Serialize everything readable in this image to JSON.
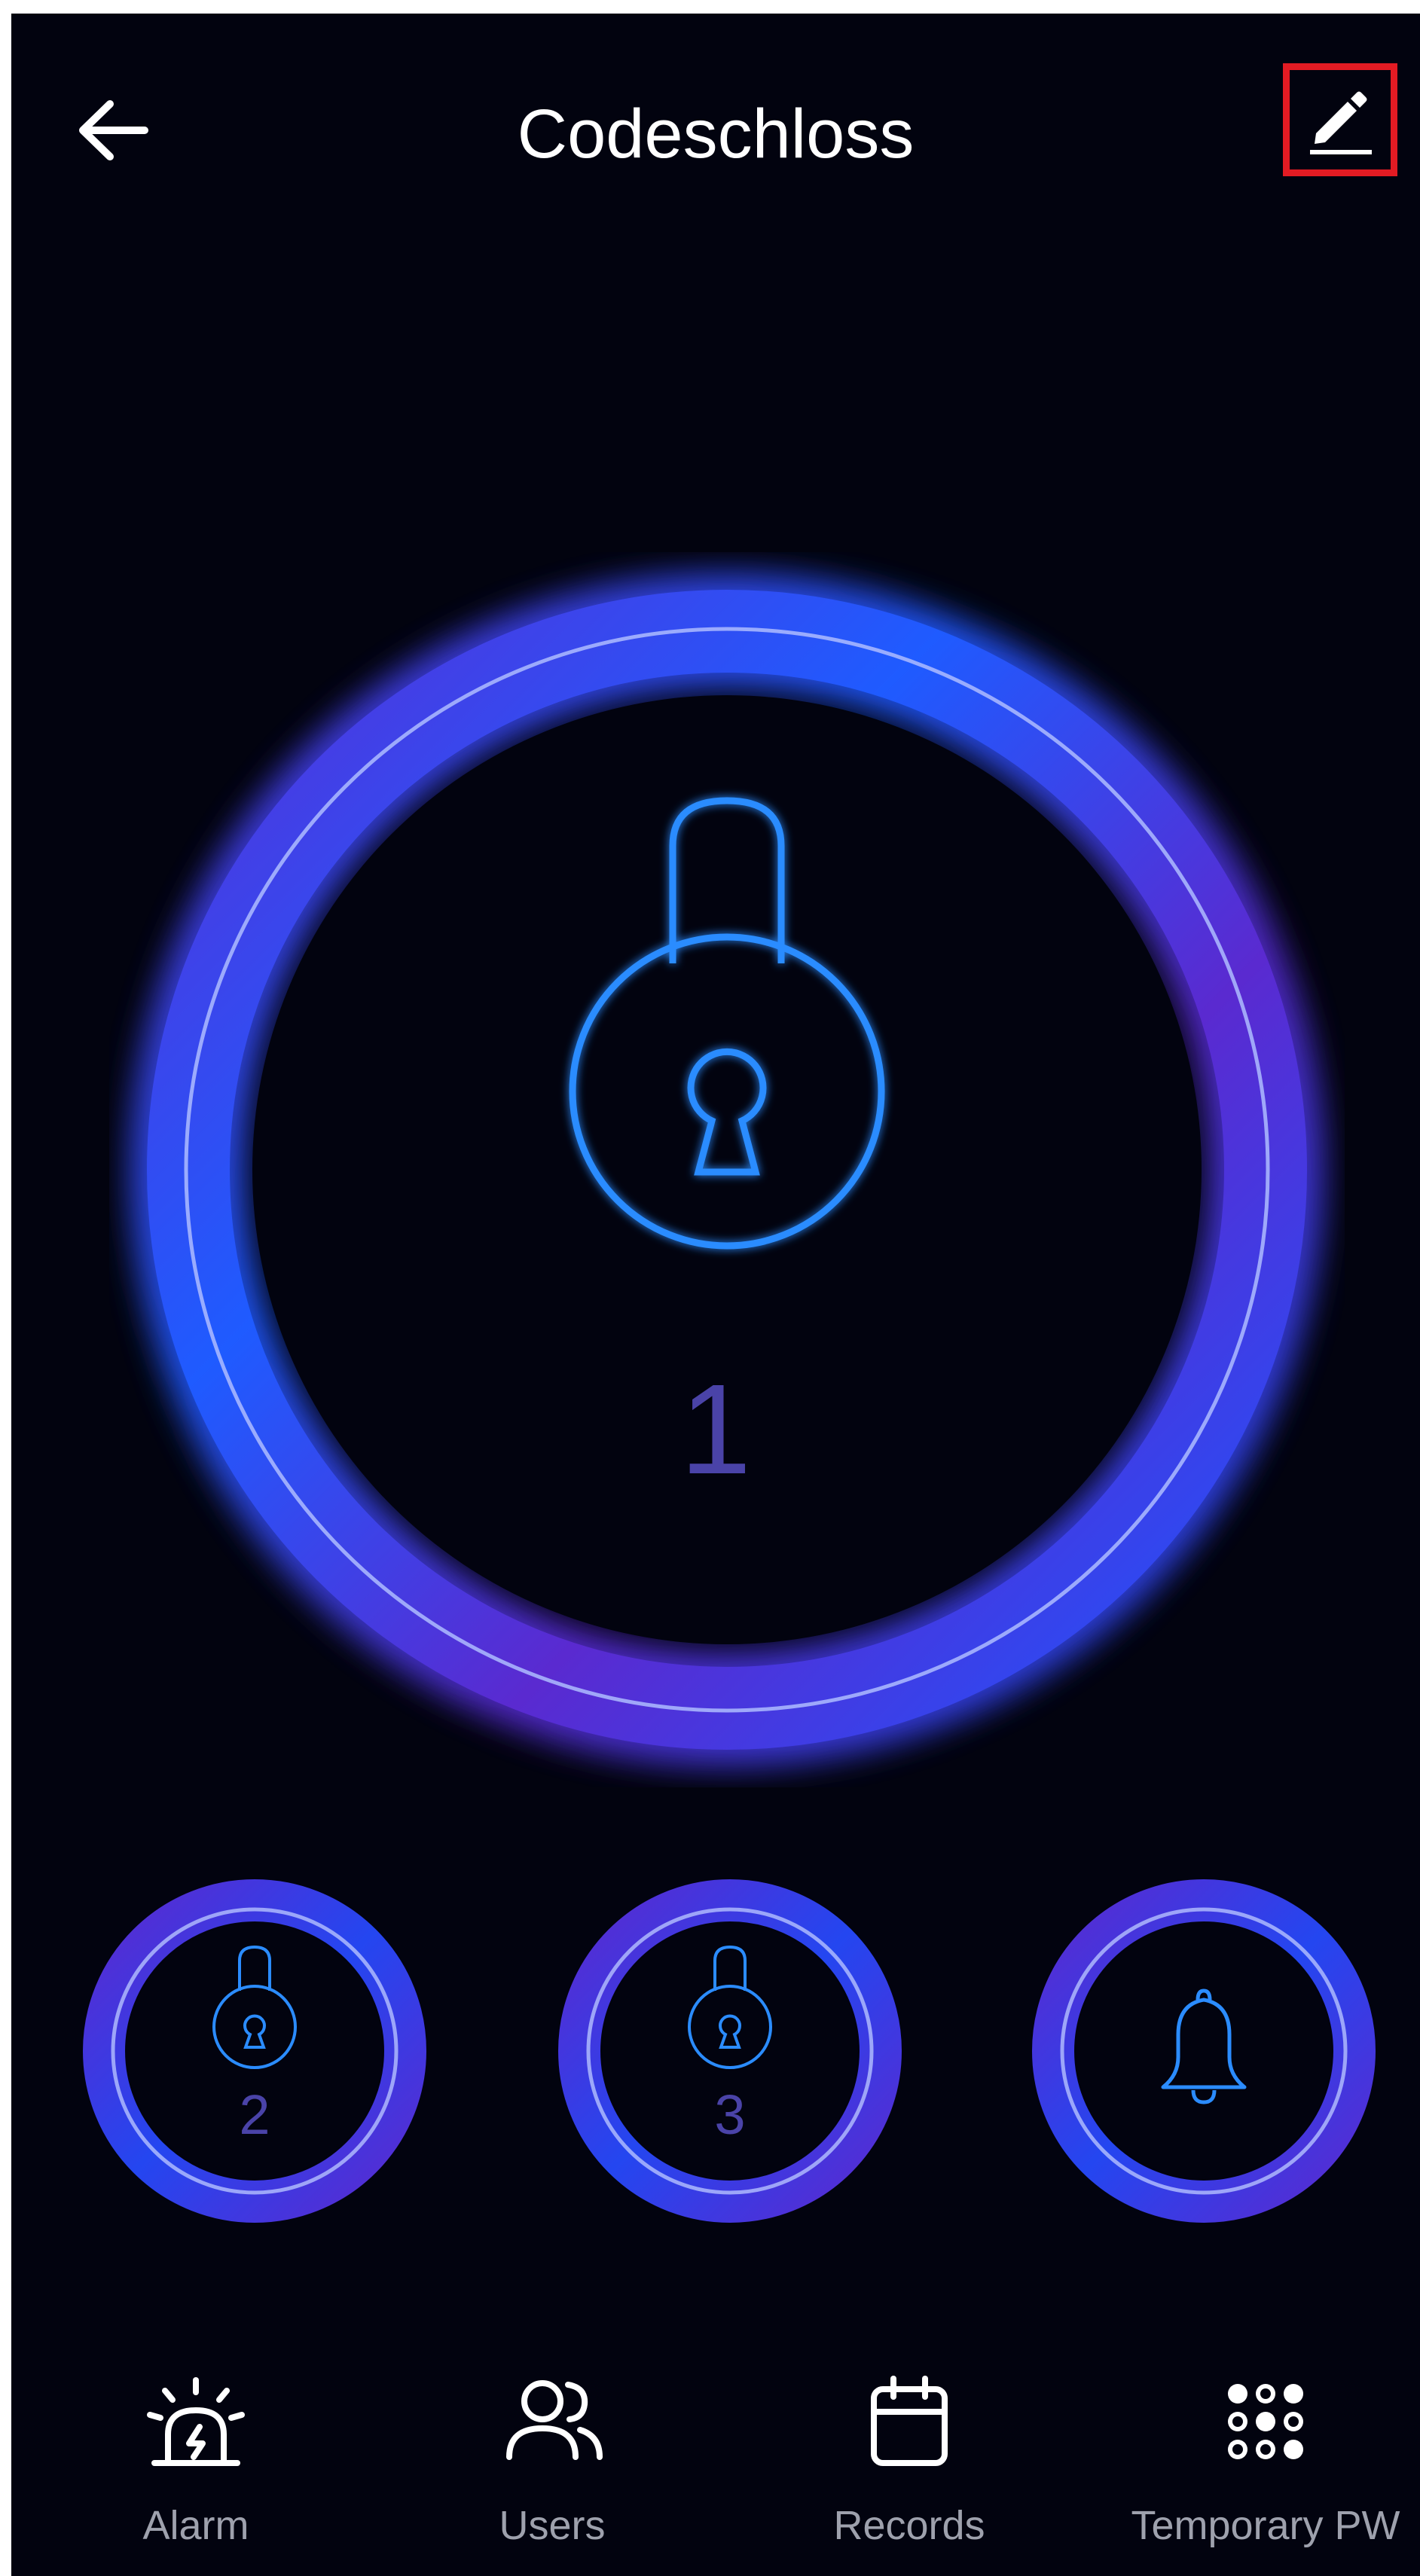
{
  "header": {
    "title": "Codeschloss",
    "back_icon": "arrow-left-icon",
    "edit_icon": "pencil-icon",
    "edit_highlight_color": "#e31b23"
  },
  "main_lock": {
    "number": "1",
    "icon": "padlock-icon",
    "ring_colors": [
      "#1f4dff",
      "#5a2bd0"
    ],
    "icon_color": "#2b8cff"
  },
  "quick_actions": [
    {
      "number": "2",
      "icon": "padlock-icon"
    },
    {
      "number": "3",
      "icon": "padlock-icon"
    },
    {
      "number": "",
      "icon": "bell-icon"
    }
  ],
  "nav": [
    {
      "label": "Alarm",
      "icon": "alarm-siren-icon"
    },
    {
      "label": "Users",
      "icon": "users-icon"
    },
    {
      "label": "Records",
      "icon": "calendar-icon"
    },
    {
      "label": "Temporary PW",
      "icon": "keypad-icon"
    }
  ],
  "colors": {
    "background": "#02030f",
    "text_primary": "#ffffff",
    "text_secondary": "#9ea1ad",
    "number_color": "#4a43a8"
  }
}
